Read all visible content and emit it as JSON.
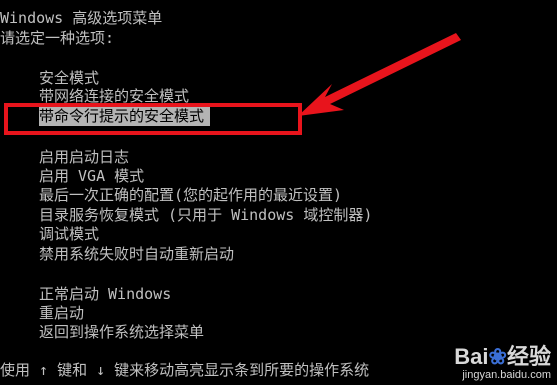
{
  "menu": {
    "title": "Windows 高级选项菜单",
    "prompt": "请选定一种选项:",
    "group1": [
      "安全模式",
      "带网络连接的安全模式",
      "带命令行提示的安全模式"
    ],
    "group2": [
      "启用启动日志",
      "启用 VGA 模式",
      "最后一次正确的配置(您的起作用的最近设置)",
      "目录服务恢复模式 (只用于 Windows 域控制器)",
      "调试模式",
      "禁用系统失败时自动重新启动"
    ],
    "group3": [
      "正常启动 Windows",
      "重启动",
      "返回到操作系统选择菜单"
    ],
    "selected_index": 2,
    "footer": "使用 ↑ 键和 ↓ 键来移动高亮显示条到所要的操作系统"
  },
  "annotation": {
    "box_color": "#e8141c",
    "arrow_color": "#e8141c"
  },
  "watermark": {
    "brand_left": "Bai",
    "brand_right": "经验",
    "site": "jingyan.baidu.com"
  },
  "colors": {
    "background": "#000000",
    "text": "#c0c0c0",
    "selection": "#b4b4b4"
  }
}
